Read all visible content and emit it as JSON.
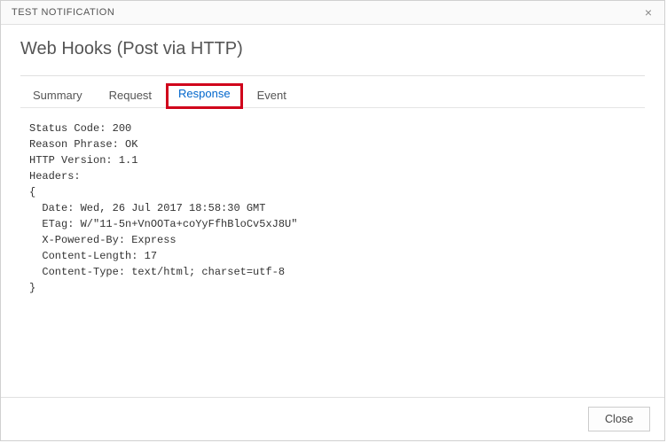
{
  "titlebar": {
    "title": "TEST NOTIFICATION",
    "close_glyph": "×"
  },
  "header": {
    "page_title": "Web Hooks (Post via HTTP)"
  },
  "tabs": [
    {
      "label": "Summary",
      "active": false,
      "highlighted": false
    },
    {
      "label": "Request",
      "active": false,
      "highlighted": false
    },
    {
      "label": "Response",
      "active": true,
      "highlighted": true
    },
    {
      "label": "Event",
      "active": false,
      "highlighted": false
    }
  ],
  "response_body": "Status Code: 200\nReason Phrase: OK\nHTTP Version: 1.1\nHeaders:\n{\n  Date: Wed, 26 Jul 2017 18:58:30 GMT\n  ETag: W/\"11-5n+VnOOTa+coYyFfhBloCv5xJ8U\"\n  X-Powered-By: Express\n  Content-Length: 17\n  Content-Type: text/html; charset=utf-8\n}",
  "footer": {
    "close_label": "Close"
  }
}
